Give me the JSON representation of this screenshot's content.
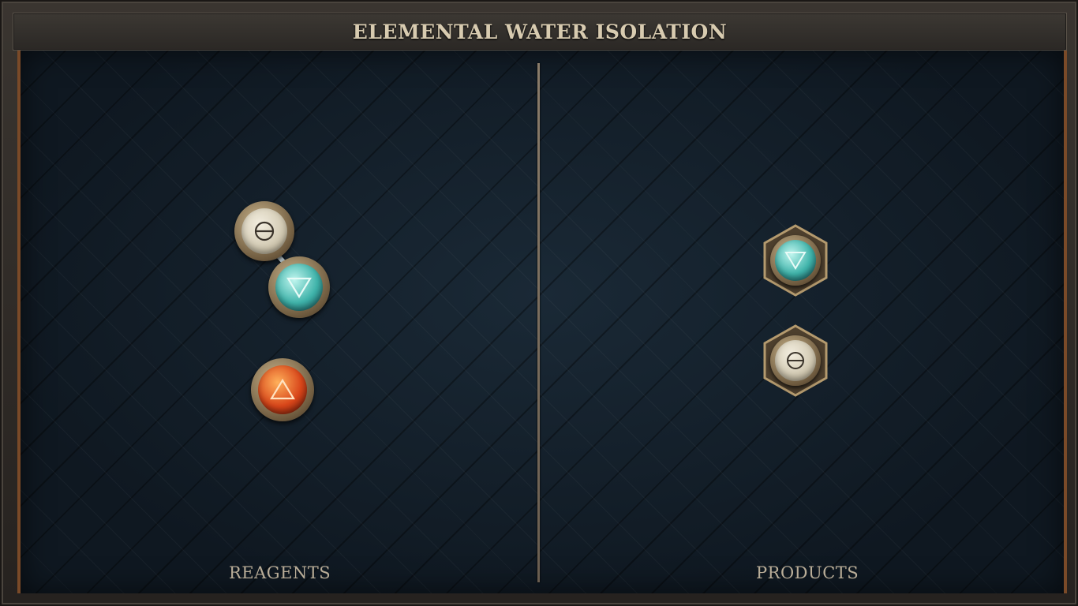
{
  "header": {
    "title": "ELEMENTAL WATER ISOLATION"
  },
  "panels": {
    "reagents_label": "REAGENTS",
    "products_label": "PRODUCTS"
  },
  "atoms": {
    "reagent_salt": {
      "element": "salt",
      "icon": "salt-icon"
    },
    "reagent_water": {
      "element": "water",
      "icon": "water-icon"
    },
    "reagent_fire": {
      "element": "fire",
      "icon": "fire-icon"
    },
    "product_water": {
      "element": "water",
      "icon": "water-icon"
    },
    "product_salt": {
      "element": "salt",
      "icon": "salt-icon"
    }
  },
  "bonds": [
    {
      "from": "reagent_salt",
      "to": "reagent_water"
    }
  ],
  "colors": {
    "board": "#111c26",
    "frame_accent": "#7a4a28",
    "title_text": "#d8cbb0",
    "water": "#3fb3aa",
    "fire": "#d8461a",
    "salt": "#cfc6ae"
  }
}
